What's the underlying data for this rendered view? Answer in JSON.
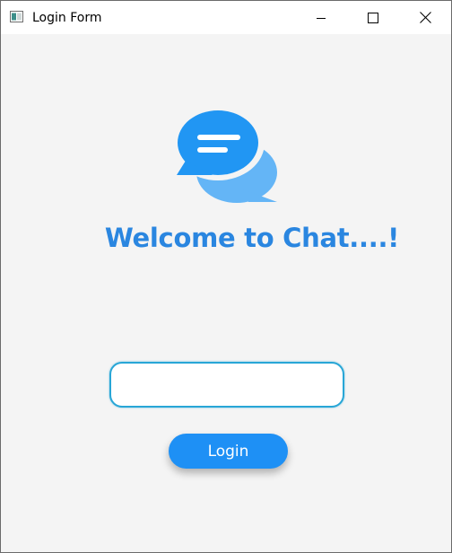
{
  "window": {
    "title": "Login Form",
    "controls": {
      "minimize": "minimize-icon",
      "maximize": "maximize-icon",
      "close": "close-icon"
    }
  },
  "main": {
    "logo_icon": "chat-bubbles-icon",
    "welcome_text": "Welcome to Chat....!",
    "username_input": {
      "value": "",
      "placeholder": ""
    },
    "login_label": "Login"
  },
  "colors": {
    "accent": "#2a86e0",
    "button": "#1e90f5",
    "bubble_front": "#2196f3",
    "bubble_back": "#64b5f6",
    "input_border": "#28a6d6",
    "background": "#f4f4f4"
  }
}
